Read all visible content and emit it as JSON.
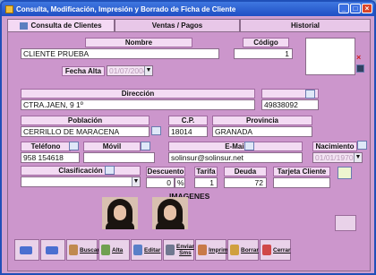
{
  "window": {
    "title": "Consulta, Modificación, Impresión y Borrado de Ficha de Cliente"
  },
  "tabs": [
    {
      "label": "Consulta de Clientes",
      "active": true
    },
    {
      "label": "Ventas / Pagos",
      "active": false
    },
    {
      "label": "Historial",
      "active": false
    }
  ],
  "form": {
    "nombre": {
      "label": "Nombre",
      "value": "CLIENTE PRUEBA"
    },
    "codigo": {
      "label": "Código",
      "value": "1"
    },
    "fecha_alta": {
      "label": "Fecha Alta",
      "value": "01/07/2004"
    },
    "direccion": {
      "label": "Dirección",
      "value": "CTRA.JAEN, 9 1º"
    },
    "telefono2": {
      "value": "49838092"
    },
    "poblacion": {
      "label": "Población",
      "value": "CERRILLO DE MARACENA"
    },
    "cp": {
      "label": "C.P.",
      "value": "18014"
    },
    "provincia": {
      "label": "Provincia",
      "value": "GRANADA"
    },
    "telefono": {
      "label": "Teléfono",
      "value": "958 154618"
    },
    "movil": {
      "label": "Móvil",
      "value": ""
    },
    "email": {
      "label": "E-Mail",
      "value": "solinsur@solinsur.net"
    },
    "nacimiento": {
      "label": "Nacimiento",
      "value": "01/01/1970"
    },
    "clasificacion": {
      "label": "Clasificación",
      "value": ""
    },
    "descuento": {
      "label": "Descuento",
      "value": "0",
      "unit": "%"
    },
    "tarifa": {
      "label": "Tarifa",
      "value": "1"
    },
    "deuda": {
      "label": "Deuda",
      "value": "72"
    },
    "tarjeta_cliente": {
      "label": "Tarjeta Cliente",
      "value": ""
    }
  },
  "imagenes": {
    "label": "IMAGENES"
  },
  "toolbar": {
    "buscar": "Buscar",
    "alta": "Alta",
    "editar": "Editar",
    "enviar_sms": "Enviar Sms",
    "imprime": "Imprime",
    "borrar": "Borrar",
    "cerrar": "Cerrar"
  },
  "colors": {
    "titlebar": "#1f4fc4",
    "panel": "#cc96cc",
    "label_bg": "#f3dbf3"
  }
}
